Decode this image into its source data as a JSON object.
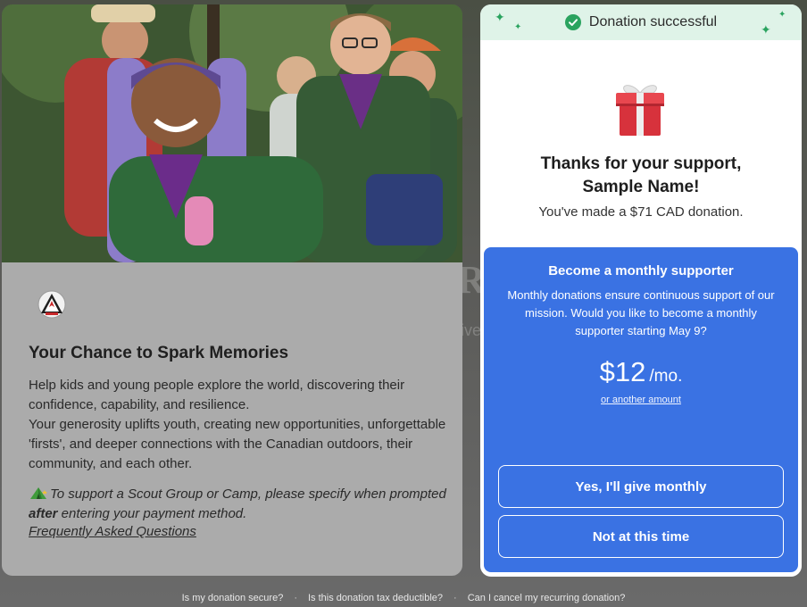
{
  "background": {
    "partial_word_1": "Ro",
    "partial_word_2": "ive"
  },
  "campaign": {
    "hero_image": "scouts-group-photo",
    "logo": "scouts-canada-logo",
    "title": "Your Chance to Spark Memories",
    "body_lines": [
      "Help kids and young people explore the world, discovering their confidence, capability, and resilience.",
      "Your generosity uplifts youth, creating new opportunities, unforgettable 'firsts', and deeper connections with the Canadian outdoors, their community, and each other."
    ],
    "note_pre": "To support a Scout Group or Camp, please specify when prompted ",
    "note_emphasis": "after",
    "note_post": " entering your payment method.",
    "faq_link": "Frequently Asked Questions",
    "note_icon": "tent-icon"
  },
  "success": {
    "banner": "Donation successful",
    "banner_icon": "check-circle-icon",
    "gift_icon": "gift-icon",
    "thanks_line1": "Thanks for your support,",
    "thanks_line2": "Sample Name!",
    "made_text": "You've made a $71 CAD donation."
  },
  "monthly": {
    "title": "Become a monthly supporter",
    "description": "Monthly donations ensure continuous support of our mission. Would you like to become a monthly supporter starting May 9?",
    "amount": "$12",
    "period": "/mo.",
    "other_amount_link": "or another amount",
    "yes_button": "Yes, I'll give monthly",
    "no_button": "Not at this time"
  },
  "footer_links": [
    "Is my donation secure?",
    "Is this donation tax deductible?",
    "Can I cancel my recurring donation?"
  ],
  "footer_separator": "·",
  "colors": {
    "accent_blue": "#3a72e3",
    "success_green": "#2aa35f",
    "success_bg": "#dff3e8",
    "card_gray": "#ababab"
  }
}
